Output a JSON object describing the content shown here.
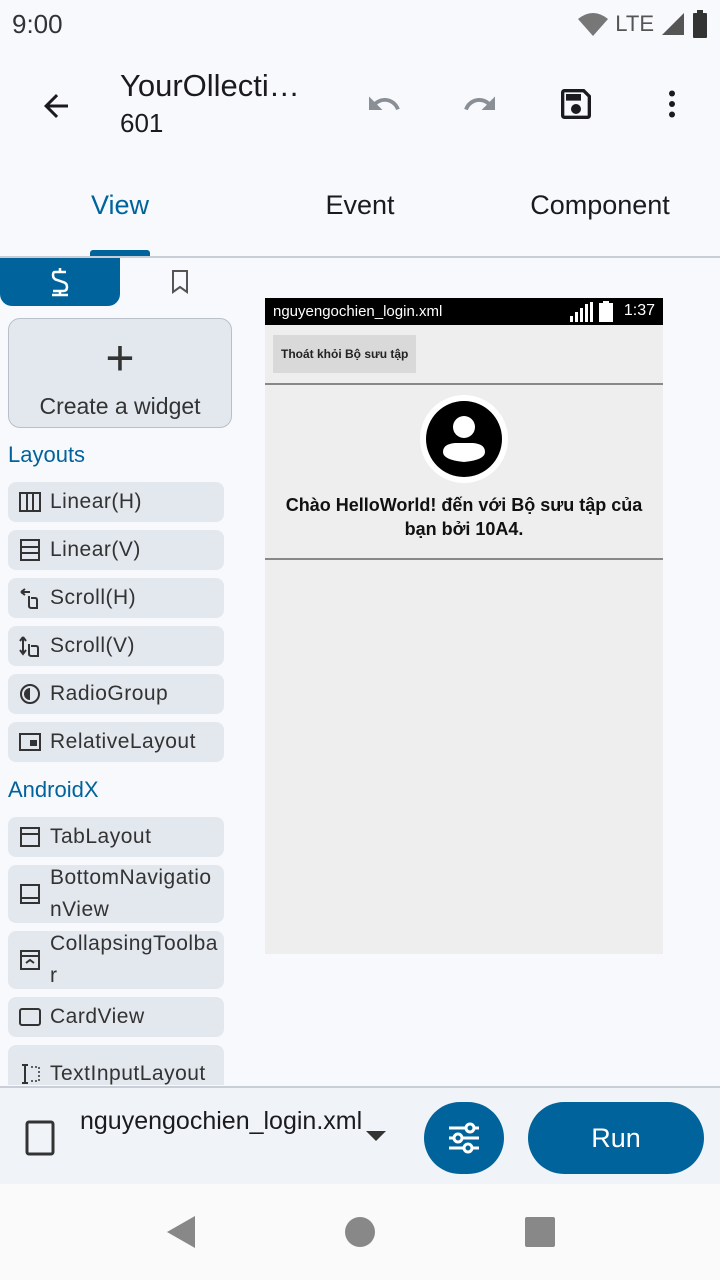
{
  "status_bar": {
    "time": "9:00",
    "network": "LTE"
  },
  "app_bar": {
    "title": "YourOllecti…",
    "subtitle": "601"
  },
  "tabs": [
    {
      "label": "View"
    },
    {
      "label": "Event"
    },
    {
      "label": "Component"
    }
  ],
  "palette": {
    "create_widget_label": "Create a widget",
    "layouts_header": "Layouts",
    "layouts": [
      {
        "label": "Linear(H)",
        "icon": "linear-horizontal-icon"
      },
      {
        "label": "Linear(V)",
        "icon": "linear-vertical-icon"
      },
      {
        "label": "Scroll(H)",
        "icon": "scroll-horizontal-icon"
      },
      {
        "label": "Scroll(V)",
        "icon": "scroll-vertical-icon"
      },
      {
        "label": "RadioGroup",
        "icon": "radio-group-icon"
      },
      {
        "label": "RelativeLayout",
        "icon": "relative-layout-icon"
      }
    ],
    "androidx_header": "AndroidX",
    "androidx": [
      {
        "label": "TabLayout",
        "icon": "tab-layout-icon"
      },
      {
        "label": "BottomNavigationView",
        "icon": "bottom-navigation-icon"
      },
      {
        "label": "CollapsingToolbar",
        "icon": "collapsing-toolbar-icon"
      },
      {
        "label": "CardView",
        "icon": "card-view-icon"
      },
      {
        "label": "TextInputLayout",
        "icon": "text-input-layout-icon"
      }
    ]
  },
  "preview": {
    "status_file": "nguyengochien_login.xml",
    "status_time": "1:37",
    "exit_button": "Thoát khỏi Bộ sưu tập",
    "welcome_text": "Chào HelloWorld! đến với Bộ sưu tập của bạn bởi 10A4."
  },
  "bottom_bar": {
    "file_name": "nguyengochien_login.xml",
    "run_label": "Run"
  },
  "colors": {
    "accent": "#00639b",
    "surface": "#f7f9fd",
    "chip": "#e3e8ef",
    "preview_bg": "#eeeeee"
  }
}
